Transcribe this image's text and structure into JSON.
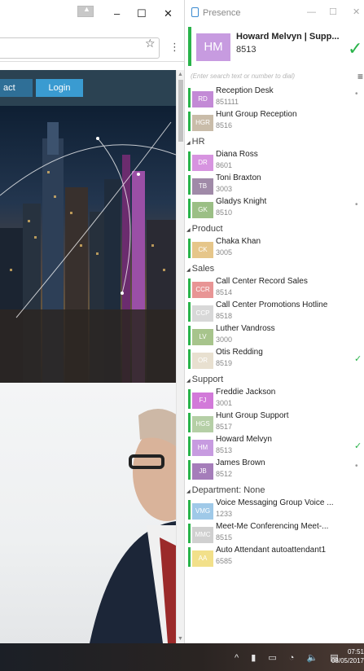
{
  "browser": {
    "profile_icon": "person-icon",
    "min_glyph": "–",
    "max_glyph": "☐",
    "close_glyph": "✕",
    "star_glyph": "☆",
    "menu_glyph": "⋮",
    "nav": {
      "contact_label": "act",
      "login_label": "Login"
    },
    "scroll_up": "▲",
    "scroll_down": "▼"
  },
  "presence": {
    "title": "Presence",
    "min_glyph": "—",
    "max_glyph": "☐",
    "close_glyph": "✕",
    "me": {
      "initials": "HM",
      "name": "Howard Melvyn | Supp...",
      "ext": "8513",
      "status_glyph": "✓"
    },
    "search_placeholder": "(Enter search text or number to dial)",
    "menu_glyph": "≡",
    "groups": [
      {
        "name": "",
        "contacts": [
          {
            "initials": "RD",
            "name": "Reception Desk",
            "ext": "851111",
            "color": "#c38ad6",
            "status": "•"
          },
          {
            "initials": "HGR",
            "name": "Hunt Group Reception",
            "ext": "8516",
            "color": "#c9bca9",
            "status": ""
          }
        ]
      },
      {
        "name": "HR",
        "contacts": [
          {
            "initials": "DR",
            "name": "Diana Ross",
            "ext": "8601",
            "color": "#d794e0",
            "status": ""
          },
          {
            "initials": "TB",
            "name": "Toni Braxton",
            "ext": "3003",
            "color": "#a08aa8",
            "status": ""
          },
          {
            "initials": "GK",
            "name": "Gladys Knight",
            "ext": "8510",
            "color": "#9bbf85",
            "status": "•"
          }
        ]
      },
      {
        "name": "Product",
        "contacts": [
          {
            "initials": "CK",
            "name": "Chaka Khan",
            "ext": "3005",
            "color": "#e6c68a",
            "status": ""
          }
        ]
      },
      {
        "name": "Sales",
        "contacts": [
          {
            "initials": "CCR",
            "name": "Call Center Record Sales",
            "ext": "8514",
            "color": "#e89595",
            "status": ""
          },
          {
            "initials": "CCP",
            "name": "Call Center Promotions Hotline",
            "ext": "8518",
            "color": "#d8d8d8",
            "status": ""
          },
          {
            "initials": "LV",
            "name": "Luther Vandross",
            "ext": "3000",
            "color": "#a7c48c",
            "status": ""
          },
          {
            "initials": "OR",
            "name": "Otis Redding",
            "ext": "8519",
            "color": "#e8e0d0",
            "status": "✓"
          }
        ]
      },
      {
        "name": "Support",
        "contacts": [
          {
            "initials": "FJ",
            "name": "Freddie Jackson",
            "ext": "3001",
            "color": "#d27ad9",
            "status": ""
          },
          {
            "initials": "HGS",
            "name": "Hunt Group Support",
            "ext": "8517",
            "color": "#b5cfa6",
            "status": ""
          },
          {
            "initials": "HM",
            "name": "Howard Melvyn",
            "ext": "8513",
            "color": "#c79be0",
            "status": "✓"
          },
          {
            "initials": "JB",
            "name": "James Brown",
            "ext": "8512",
            "color": "#a57dba",
            "status": "•"
          }
        ]
      },
      {
        "name": "Department: None",
        "contacts": [
          {
            "initials": "VMG",
            "name": "Voice Messaging Group Voice ...",
            "ext": "1233",
            "color": "#9fc9e8",
            "status": ""
          },
          {
            "initials": "MMC",
            "name": "Meet-Me Conferencing Meet-...",
            "ext": "8515",
            "color": "#d0d0d0",
            "status": ""
          },
          {
            "initials": "AA",
            "name": "Auto Attendant autoattendant1",
            "ext": "6585",
            "color": "#f2e08a",
            "status": ""
          }
        ]
      }
    ],
    "available_color": "#29b34a"
  },
  "taskbar": {
    "tray_icons": "^ ▮ ▭ ◔ 🔈 ▤",
    "time": "07:51",
    "date": "08/05/2017"
  }
}
